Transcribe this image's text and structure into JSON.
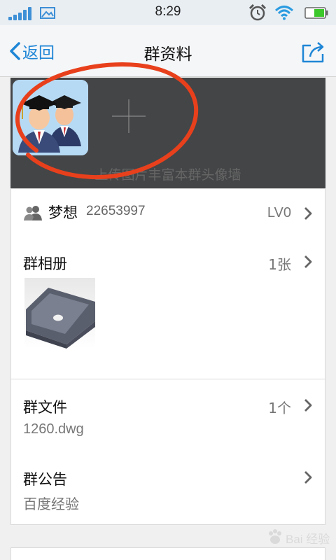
{
  "status_bar": {
    "time": "8:29",
    "icons": [
      "signal-icon",
      "picture-icon",
      "alarm-icon",
      "wifi-icon",
      "battery-icon"
    ],
    "signal_color": "#3d8fd6",
    "battery_color": "#3cc82b"
  },
  "nav": {
    "back_label": "返回",
    "title": "群资料",
    "share_icon": "share-icon",
    "accent": "#1f86d6"
  },
  "header": {
    "avatar_icon": "graduates-avatar-icon",
    "add_icon": "plus-icon",
    "hint": "上传图片丰富本群头像墙",
    "annotation_color": "#e8401c"
  },
  "member": {
    "icon": "people-icon",
    "name": "梦想",
    "group_id": "22653997",
    "level": "LV0"
  },
  "album": {
    "title": "群相册",
    "count": "1张"
  },
  "files": {
    "title": "群文件",
    "count": "1个",
    "file_name": "1260.dwg"
  },
  "notice": {
    "title": "群公告",
    "content": "百度经验"
  },
  "watermark": {
    "text": "Bai 经验"
  }
}
